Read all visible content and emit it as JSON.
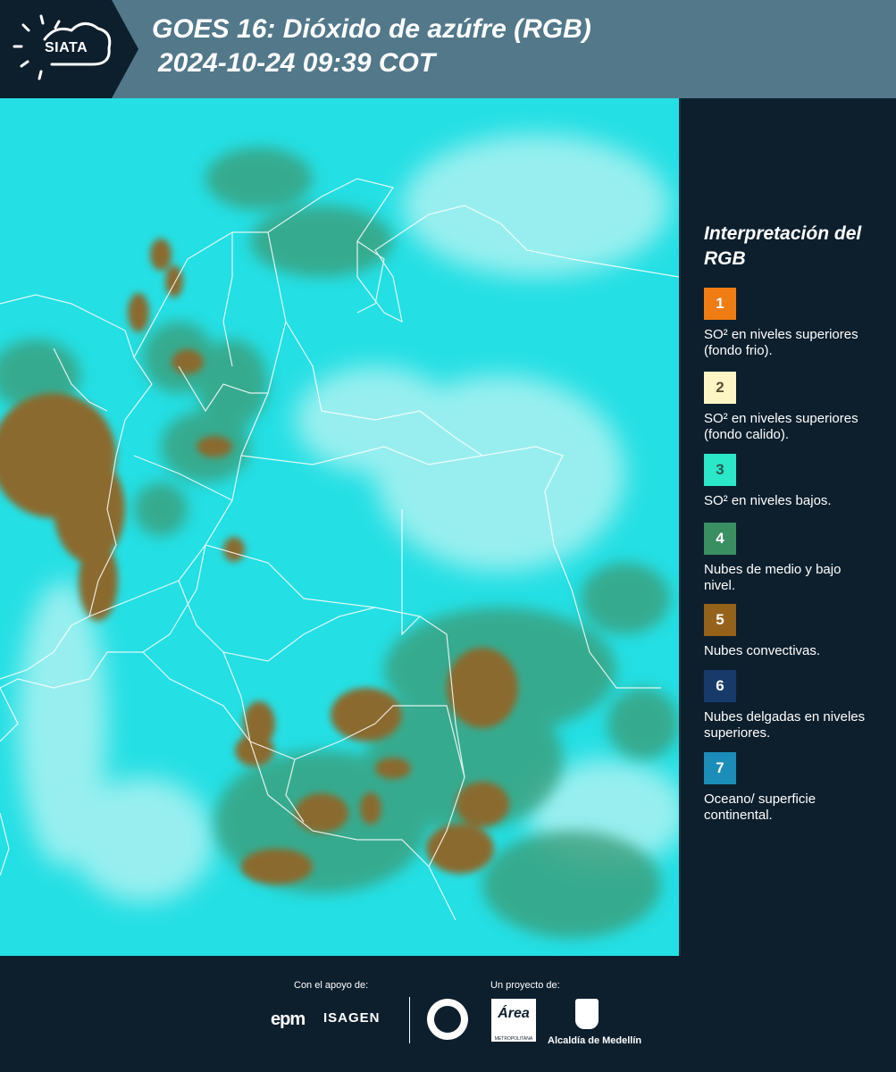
{
  "header": {
    "logo_text": "SIATA",
    "title_line1": "GOES 16: Dióxido de azúfre (RGB)",
    "title_line2": "2024-10-24 09:39 COT"
  },
  "colors": {
    "header_bg": "#52788a",
    "dark_bg": "#0d1f2d",
    "map_base": "#24dfe4",
    "convective": "#8a6a2e",
    "midlow": "#3a9e7a",
    "border_lines": "#ffffff"
  },
  "legend": {
    "title": "Interpretación del RGB",
    "items": [
      {
        "number": "1",
        "color": "#f07d14",
        "desc": "SO² en niveles superiores (fondo frio)."
      },
      {
        "number": "2",
        "color": "#fdf5c4",
        "desc": "SO² en niveles superiores (fondo calido)."
      },
      {
        "number": "3",
        "color": "#2ae8c8",
        "desc": "SO² en niveles bajos."
      },
      {
        "number": "4",
        "color": "#3a8f62",
        "desc": "Nubes de medio y bajo nivel."
      },
      {
        "number": "5",
        "color": "#94621a",
        "desc": "Nubes convectivas."
      },
      {
        "number": "6",
        "color": "#173a6a",
        "desc": "Nubes delgadas en niveles superiores."
      },
      {
        "number": "7",
        "color": "#1b8db8",
        "desc": "Oceano/ superficie continental."
      }
    ]
  },
  "footer": {
    "support_label": "Con el apoyo de:",
    "project_label": "Un proyecto de:",
    "sponsor_1": "epm",
    "sponsor_2": "ISAGEN",
    "area_logo_text": "Área",
    "area_logo_sub": "METROPOLITANA Valle de Aburrá",
    "medellin_label": "Alcaldía de Medellín"
  }
}
